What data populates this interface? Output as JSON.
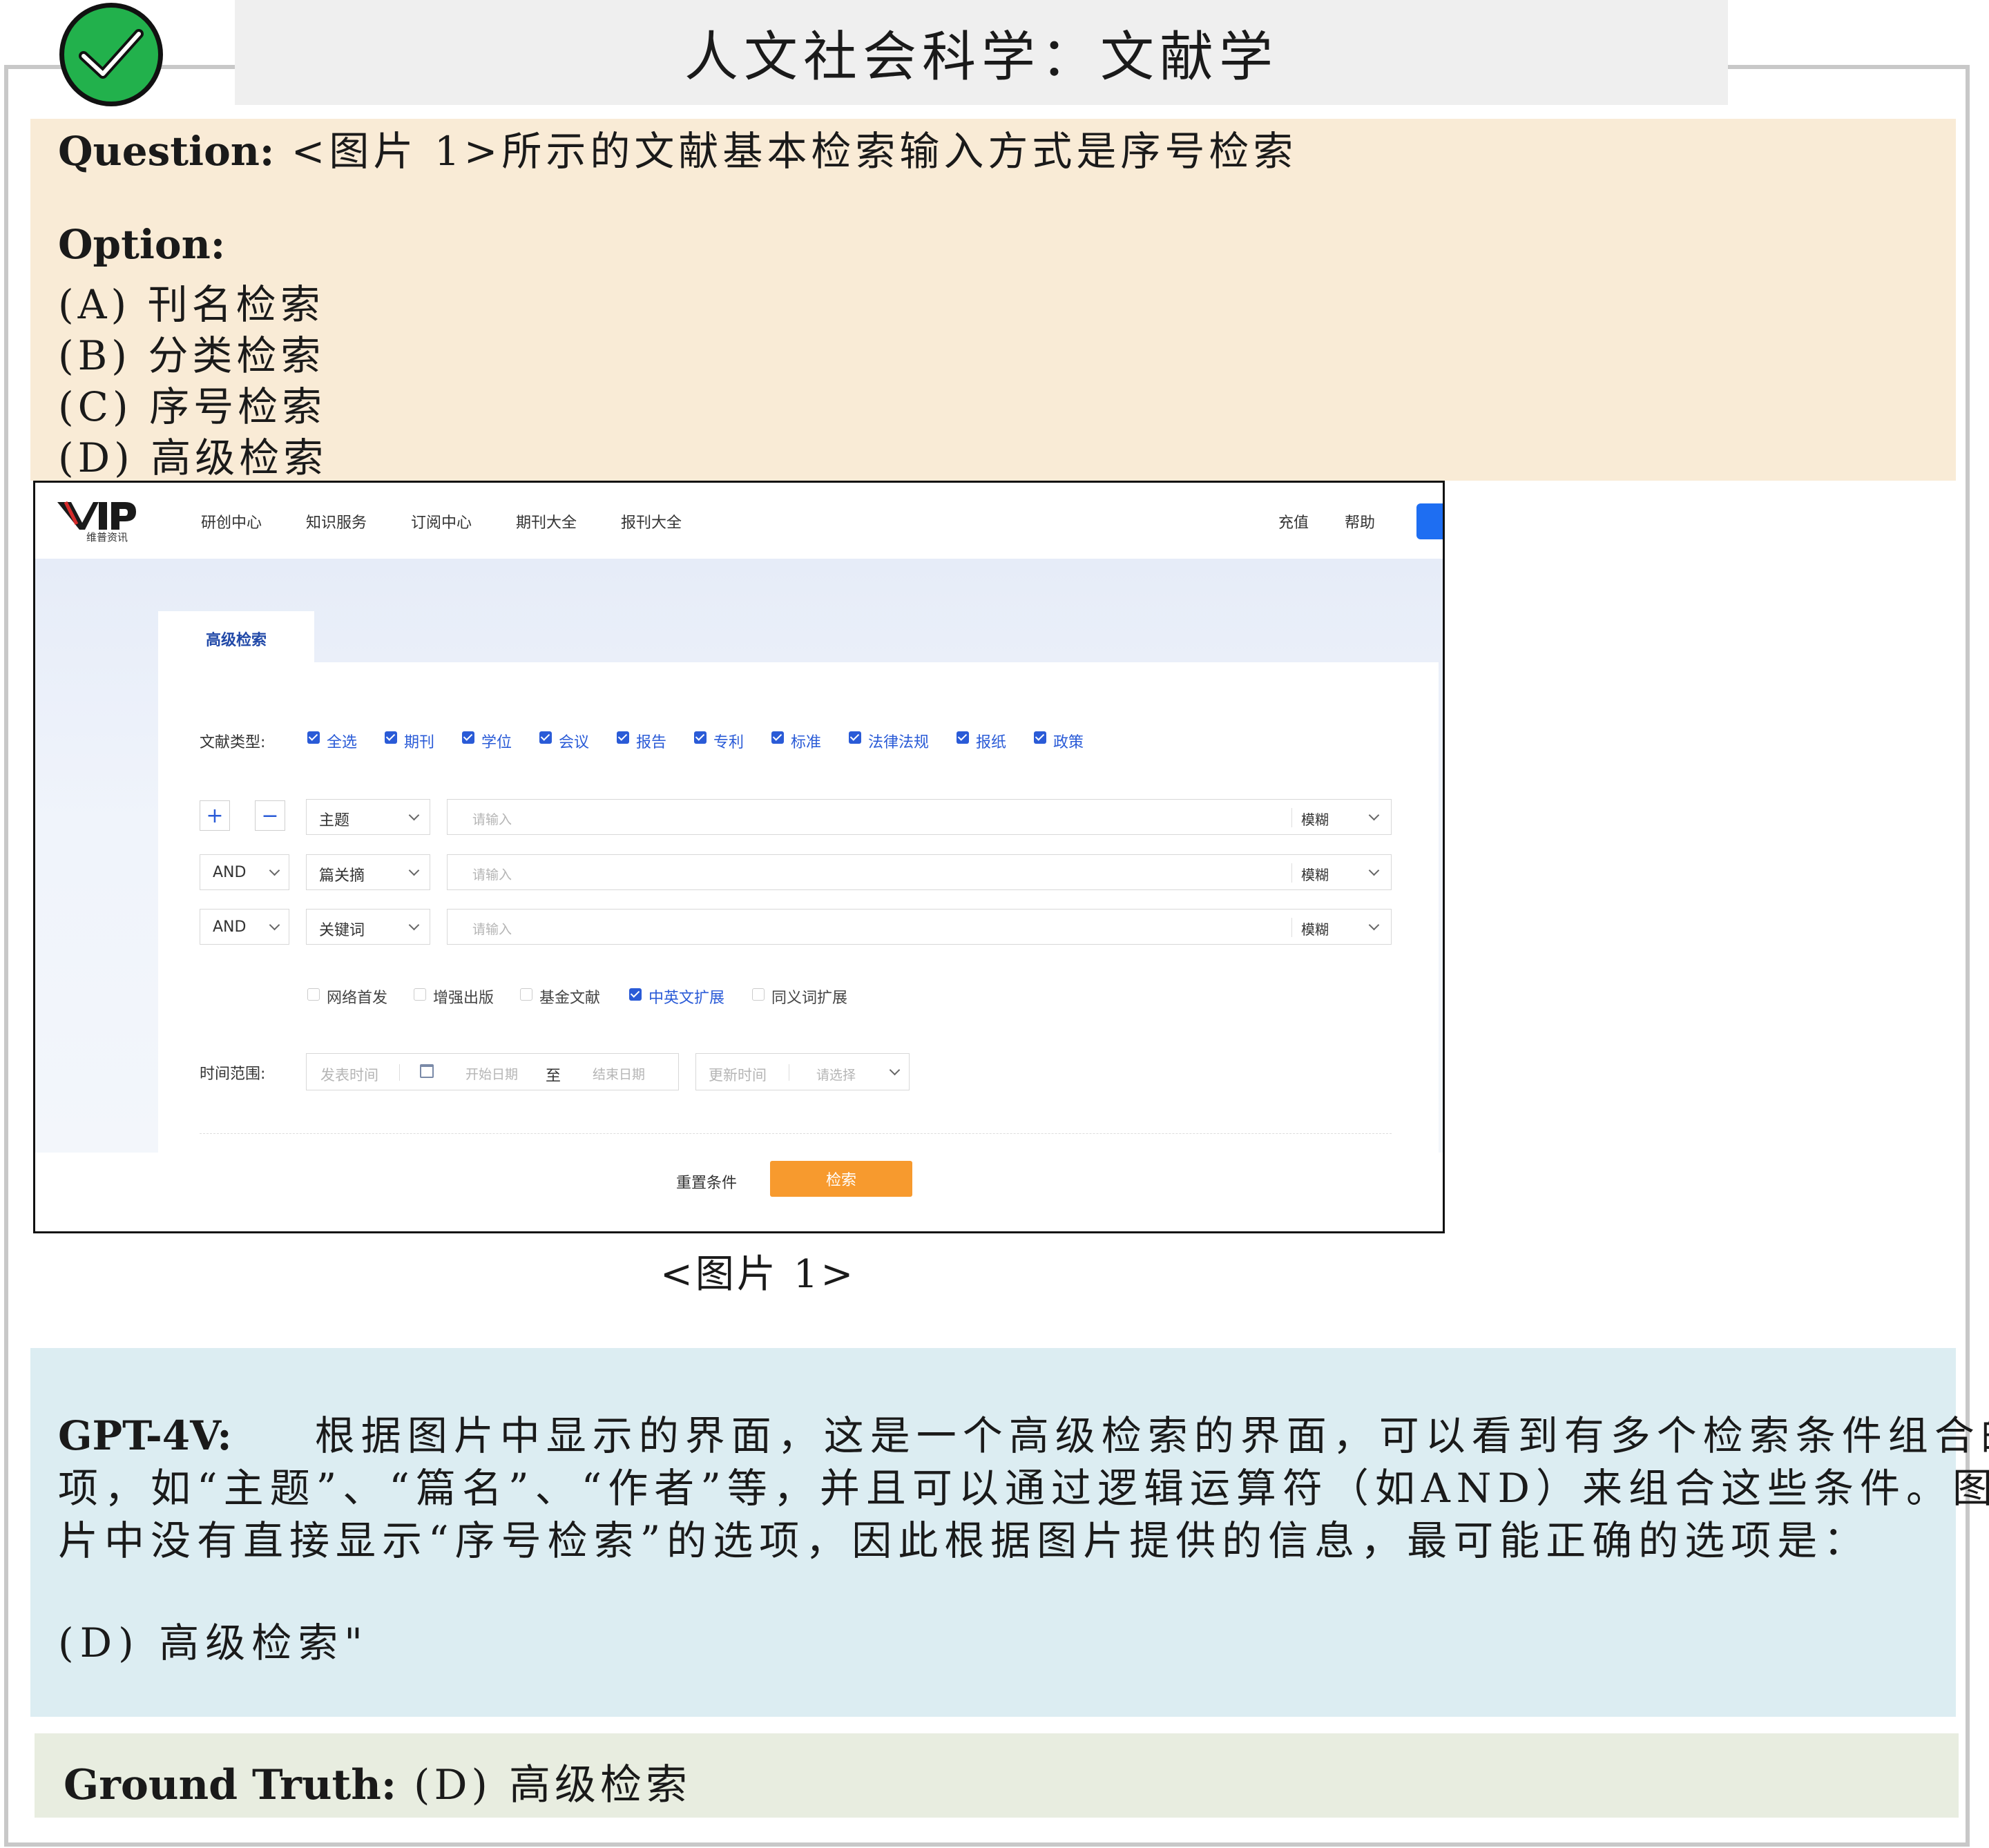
{
  "header": {
    "title": "人文社会科学：文献学"
  },
  "question": {
    "label": "Question:",
    "text": "<图片 1>所示的文献基本检索输入方式是序号检索",
    "options_label": "Option:",
    "options": [
      "(A) 刊名检索",
      "(B) 分类检索",
      "(C) 序号检索",
      "(D) 高级检索"
    ]
  },
  "screenshot": {
    "logo_sub": "维普资讯",
    "nav": [
      "研创中心",
      "知识服务",
      "订阅中心",
      "期刊大全",
      "报刊大全"
    ],
    "nav_right": [
      "充值",
      "帮助"
    ],
    "tab": "高级检索",
    "doc_type_label": "文献类型:",
    "doc_types": [
      "全选",
      "期刊",
      "学位",
      "会议",
      "报告",
      "专利",
      "标准",
      "法律法规",
      "报纸",
      "政策"
    ],
    "plus": "+",
    "minus": "−",
    "rows": [
      {
        "logic": "",
        "field": "主题",
        "placeholder": "请输入",
        "match": "模糊"
      },
      {
        "logic": "AND",
        "field": "篇关摘",
        "placeholder": "请输入",
        "match": "模糊"
      },
      {
        "logic": "AND",
        "field": "关键词",
        "placeholder": "请输入",
        "match": "模糊"
      }
    ],
    "extensions": [
      {
        "label": "网络首发",
        "checked": false
      },
      {
        "label": "增强出版",
        "checked": false
      },
      {
        "label": "基金文献",
        "checked": false
      },
      {
        "label": "中英文扩展",
        "checked": true
      },
      {
        "label": "同义词扩展",
        "checked": false
      }
    ],
    "time_label": "时间范围:",
    "publish_time": "发表时间",
    "start_date": "开始日期",
    "to": "至",
    "end_date": "结束日期",
    "update_time": "更新时间",
    "please_select": "请选择",
    "reset": "重置条件",
    "search": "检索"
  },
  "caption": "<图片 1>",
  "gpt": {
    "label": "GPT-4V:",
    "line1": "根据图片中显示的界面，这是一个高级检索的界面，可以看到有多个检索条件组合的选",
    "line2": "项，如“主题”、“篇名”、“作者”等，并且可以通过逻辑运算符（如AND）来组合这些条件。图",
    "line3": "片中没有直接显示“序号检索”的选项，因此根据图片提供的信息，最可能正确的选项是：",
    "answer": "(D) 高级检索\""
  },
  "ground_truth": {
    "label": "Ground Truth:",
    "value": "(D) 高级检索"
  },
  "colors": {
    "check_green": "#22b14c",
    "accent_blue": "#2a5bd7",
    "search_orange": "#f79a2e"
  }
}
